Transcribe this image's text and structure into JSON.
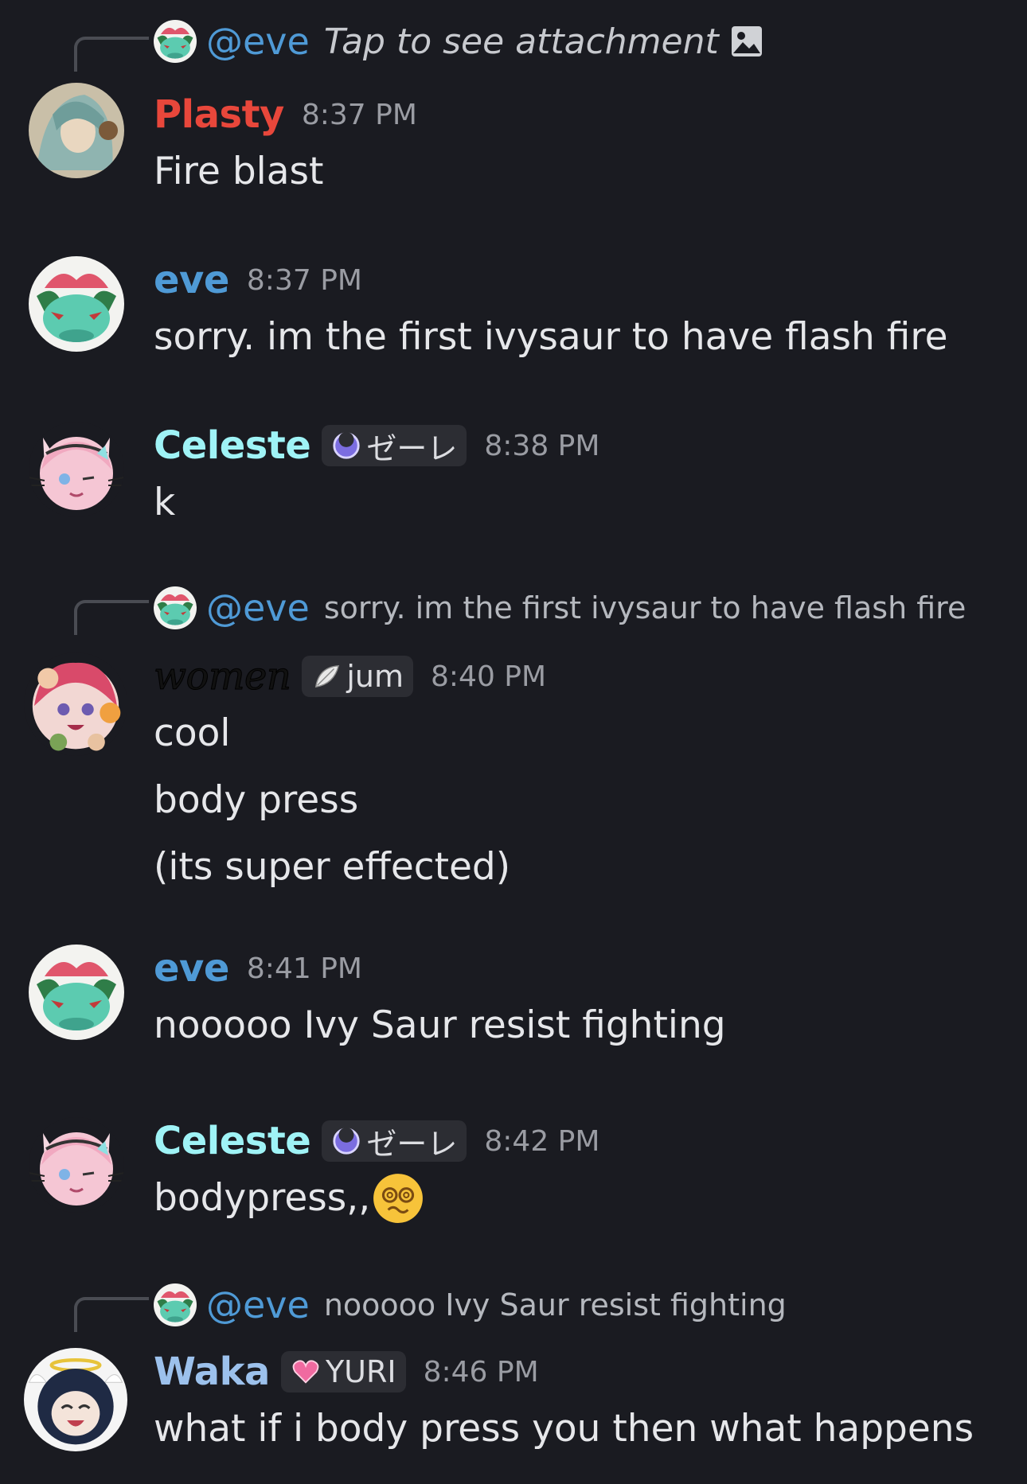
{
  "messages": [
    {
      "reply": {
        "mention": "@eve",
        "text": "Tap to see attachment",
        "attachment_icon": "image-icon"
      },
      "author": "Plasty",
      "author_color": "#e8473b",
      "time": "8:37 PM",
      "lines": [
        "Fire blast"
      ]
    },
    {
      "author": "eve",
      "author_color": "#4f9ad6",
      "time": "8:37 PM",
      "lines": [
        "sorry. im the first ivysaur to have flash fire"
      ]
    },
    {
      "author": "Celeste",
      "author_color": "#9ff3f6",
      "tag": "ゼーレ",
      "tag_icon": "moon-icon",
      "time": "8:38 PM",
      "lines": [
        "k"
      ]
    },
    {
      "reply": {
        "mention": "@eve",
        "text": "sorry. im the first ivysaur to have flash fire"
      },
      "author": "women",
      "author_color": "#111111",
      "tag": "jum",
      "tag_icon": "feather-icon",
      "time": "8:40 PM",
      "lines": [
        "cool",
        "body press",
        "(its super effected)"
      ]
    },
    {
      "author": "eve",
      "author_color": "#4f9ad6",
      "time": "8:41 PM",
      "lines": [
        "nooooo Ivy Saur resist fighting"
      ]
    },
    {
      "author": "Celeste",
      "author_color": "#9ff3f6",
      "tag": "ゼーレ",
      "tag_icon": "moon-icon",
      "time": "8:42 PM",
      "lines": [
        "bodypress,,"
      ],
      "emoji": "dizzy-face-emoji"
    },
    {
      "reply": {
        "mention": "@eve",
        "text": "nooooo Ivy Saur resist fighting"
      },
      "author": "Waka",
      "author_color": "#9cc1ec",
      "tag": "YURI",
      "tag_icon": "heart-icon",
      "time": "8:46 PM",
      "lines": [
        "what if i body press you then what happens"
      ]
    }
  ]
}
